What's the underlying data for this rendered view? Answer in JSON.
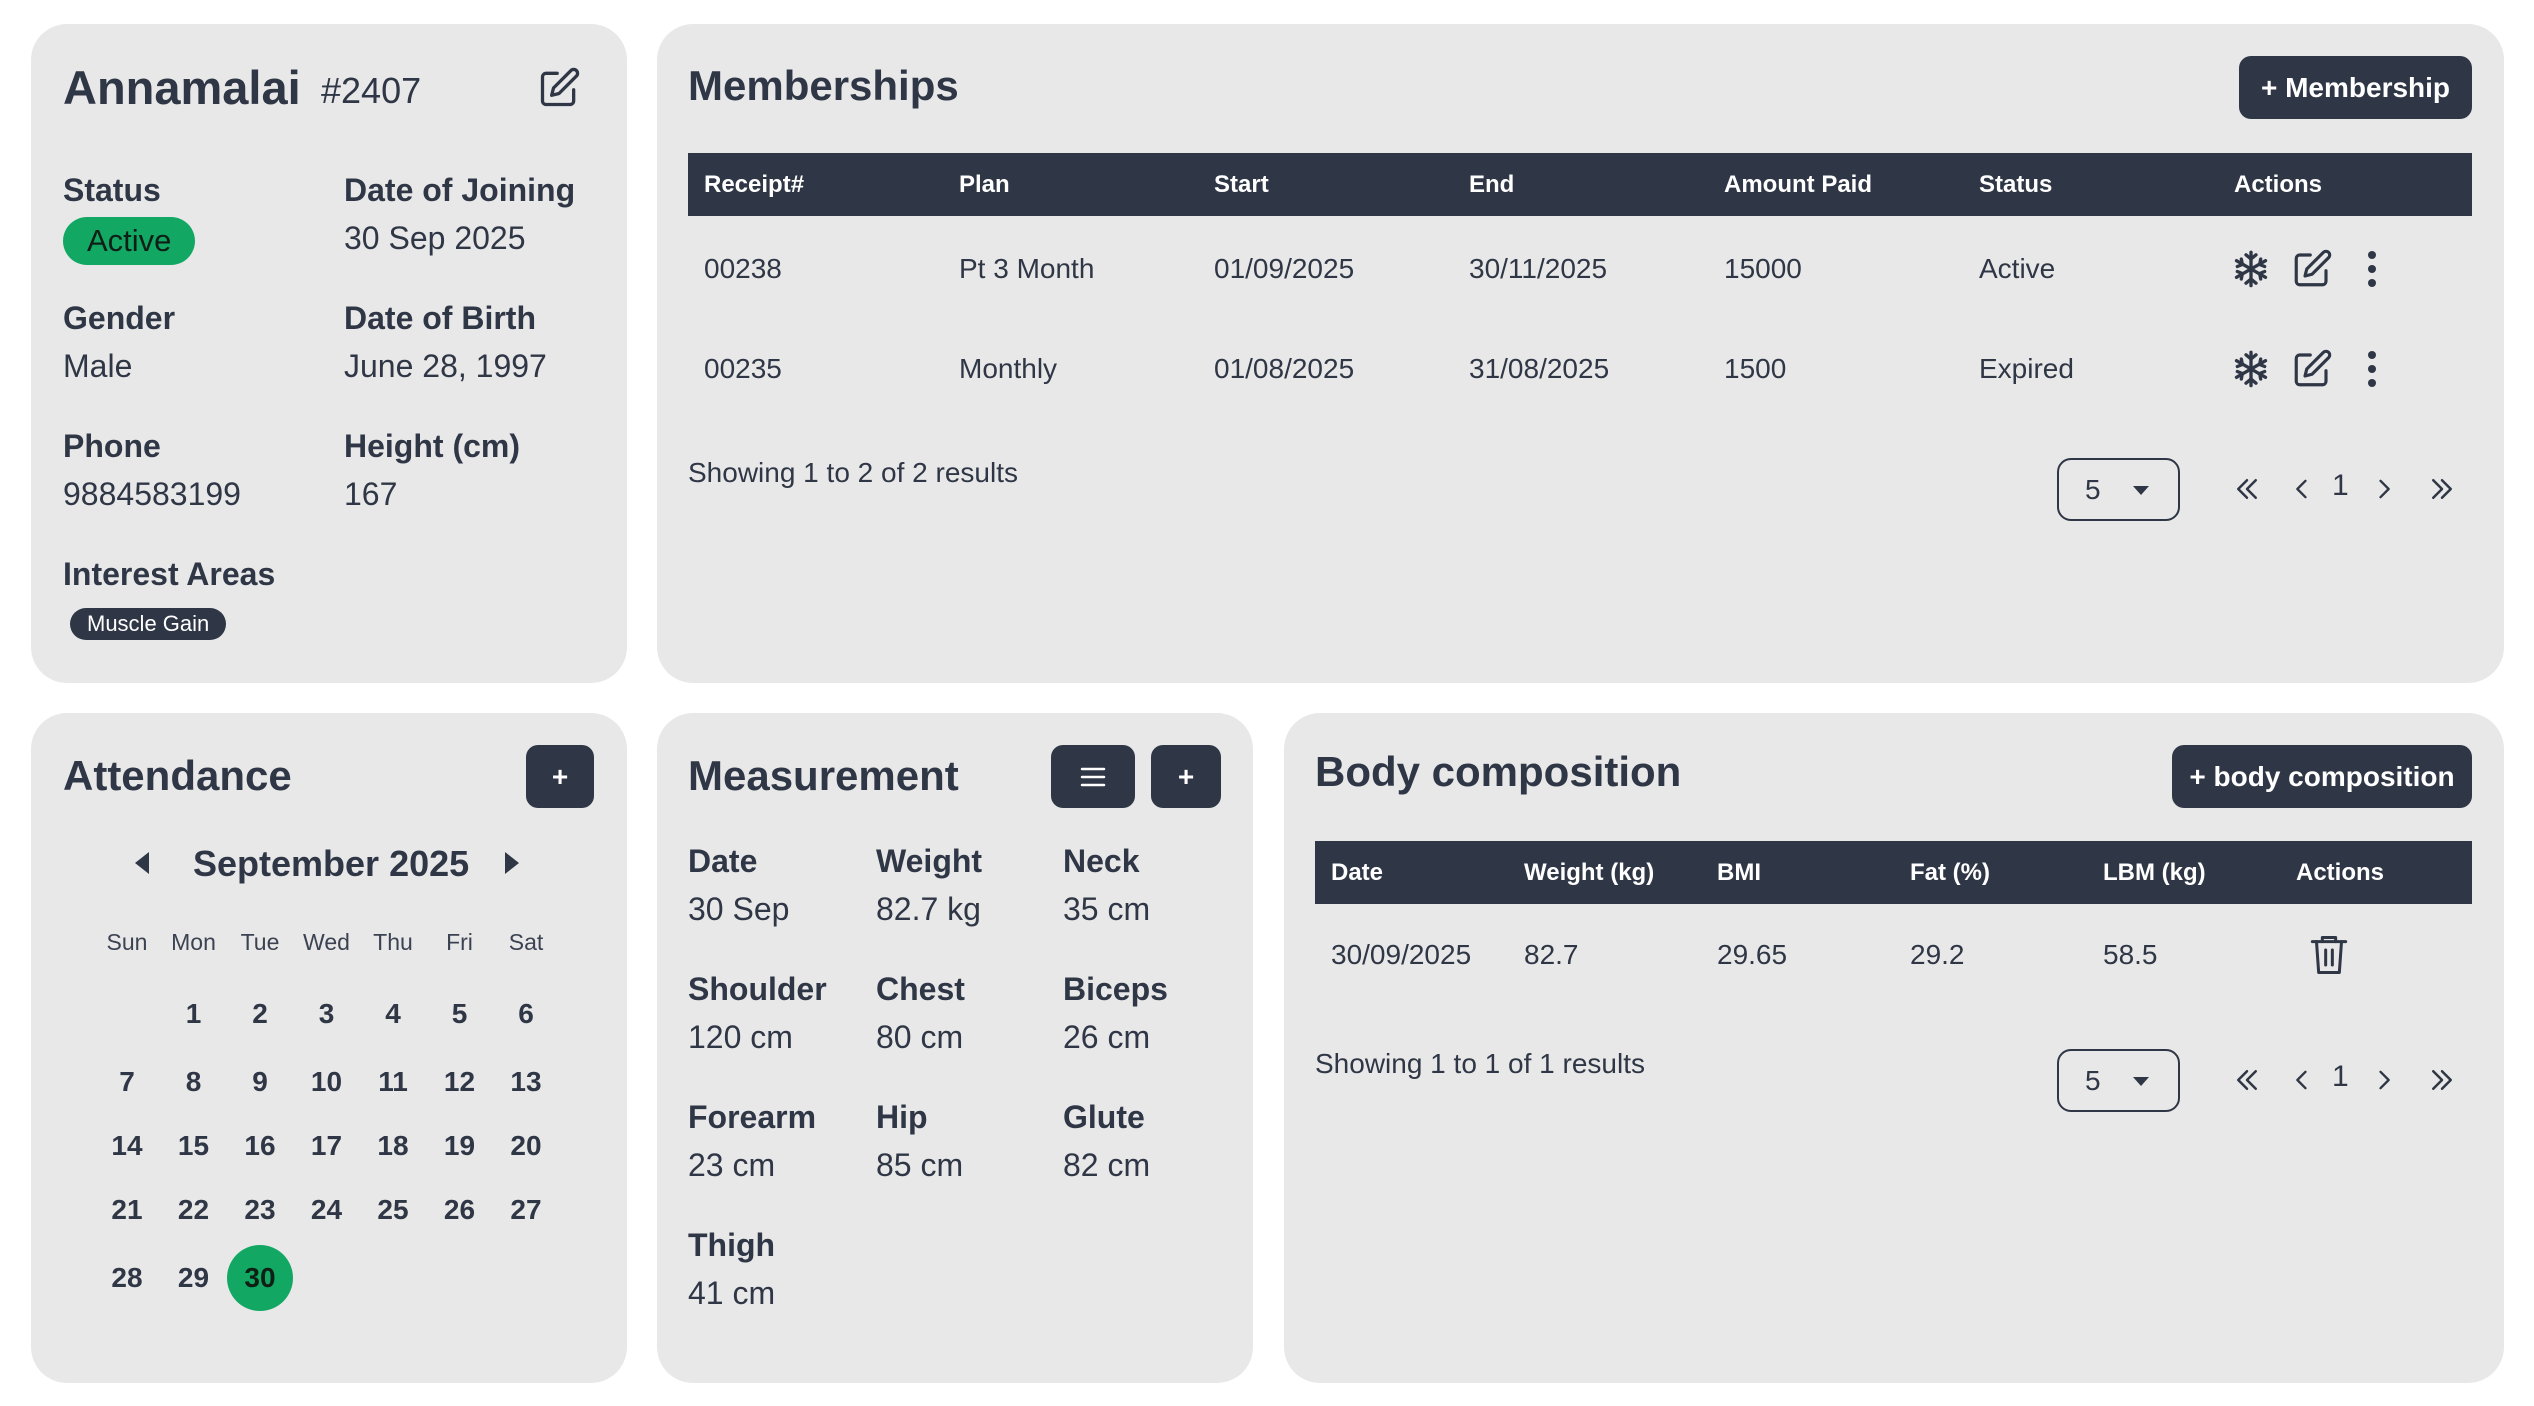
{
  "profile": {
    "name": "Annamalai",
    "id": "#2407",
    "fields": {
      "status_label": "Status",
      "status_value": "Active",
      "joining_label": "Date of Joining",
      "joining_value": "30 Sep 2025",
      "gender_label": "Gender",
      "gender_value": "Male",
      "dob_label": "Date of Birth",
      "dob_value": "June 28, 1997",
      "phone_label": "Phone",
      "phone_value": "9884583199",
      "height_label": "Height (cm)",
      "height_value": "167",
      "interest_label": "Interest Areas",
      "interest_chip": "Muscle Gain"
    }
  },
  "memberships": {
    "title": "Memberships",
    "add_label": "+ Membership",
    "columns": [
      "Receipt#",
      "Plan",
      "Start",
      "End",
      "Amount Paid",
      "Status",
      "Actions"
    ],
    "rows": [
      [
        "00238",
        "Pt 3 Month",
        "01/09/2025",
        "30/11/2025",
        "15000",
        "Active"
      ],
      [
        "00235",
        "Monthly",
        "01/08/2025",
        "31/08/2025",
        "1500",
        "Expired"
      ]
    ],
    "footer": "Showing 1 to 2 of 2 results",
    "page_size": "5",
    "page": "1"
  },
  "attendance": {
    "title": "Attendance",
    "add_label": "+",
    "month": "September 2025",
    "weekdays": [
      "Sun",
      "Mon",
      "Tue",
      "Wed",
      "Thu",
      "Fri",
      "Sat"
    ],
    "days": [
      "1",
      "2",
      "3",
      "4",
      "5",
      "6",
      "7",
      "8",
      "9",
      "10",
      "11",
      "12",
      "13",
      "14",
      "15",
      "16",
      "17",
      "18",
      "19",
      "20",
      "21",
      "22",
      "23",
      "24",
      "25",
      "26",
      "27",
      "28",
      "29",
      "30"
    ],
    "selected_day": "30"
  },
  "measurement": {
    "title": "Measurement",
    "add_label": "+",
    "items": [
      {
        "label": "Date",
        "value": "30 Sep"
      },
      {
        "label": "Weight",
        "value": "82.7 kg"
      },
      {
        "label": "Neck",
        "value": "35 cm"
      },
      {
        "label": "Shoulder",
        "value": "120 cm"
      },
      {
        "label": "Chest",
        "value": "80 cm"
      },
      {
        "label": "Biceps",
        "value": "26 cm"
      },
      {
        "label": "Forearm",
        "value": "23 cm"
      },
      {
        "label": "Hip",
        "value": "85 cm"
      },
      {
        "label": "Glute",
        "value": "82 cm"
      },
      {
        "label": "Thigh",
        "value": "41 cm"
      }
    ]
  },
  "body_composition": {
    "title": "Body composition",
    "add_label": "+ body composition",
    "columns": [
      "Date",
      "Weight (kg)",
      "BMI",
      "Fat (%)",
      "LBM (kg)",
      "Actions"
    ],
    "rows": [
      [
        "30/09/2025",
        "82.7",
        "29.65",
        "29.2",
        "58.5"
      ]
    ],
    "footer": "Showing 1 to 1 of 1 results",
    "page_size": "5",
    "page": "1"
  },
  "colors": {
    "dark": "#2f3645",
    "card": "#e8e8e8",
    "accent_green": "#12a864"
  },
  "icons": [
    "edit-icon",
    "snowflake-icon",
    "more-vertical-icon",
    "trash-icon",
    "menu-icon",
    "caret-left-icon",
    "caret-right-icon",
    "chevron-double-left-icon",
    "chevron-left-icon",
    "chevron-right-icon",
    "chevron-double-right-icon",
    "caret-down-icon"
  ]
}
